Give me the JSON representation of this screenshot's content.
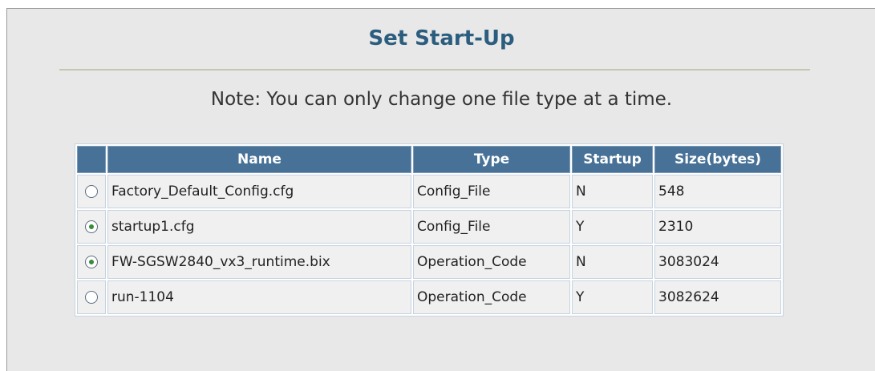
{
  "title": "Set Start-Up",
  "note": "Note: You can only change one file type at a time.",
  "table": {
    "headers": {
      "select": "",
      "name": "Name",
      "type": "Type",
      "startup": "Startup",
      "size": "Size(bytes)"
    },
    "rows": [
      {
        "selected": false,
        "name": "Factory_Default_Config.cfg",
        "type": "Config_File",
        "startup": "N",
        "size": "548"
      },
      {
        "selected": true,
        "name": "startup1.cfg",
        "type": "Config_File",
        "startup": "Y",
        "size": "2310"
      },
      {
        "selected": true,
        "name": "FW-SGSW2840_vx3_runtime.bix",
        "type": "Operation_Code",
        "startup": "N",
        "size": "3083024"
      },
      {
        "selected": false,
        "name": "run-1104",
        "type": "Operation_Code",
        "startup": "Y",
        "size": "3082624"
      }
    ]
  },
  "colors": {
    "title": "#2b5d7e",
    "header_bg": "#477196",
    "panel_bg": "#e8e8e8",
    "radio_selected": "#3a8a3a"
  }
}
